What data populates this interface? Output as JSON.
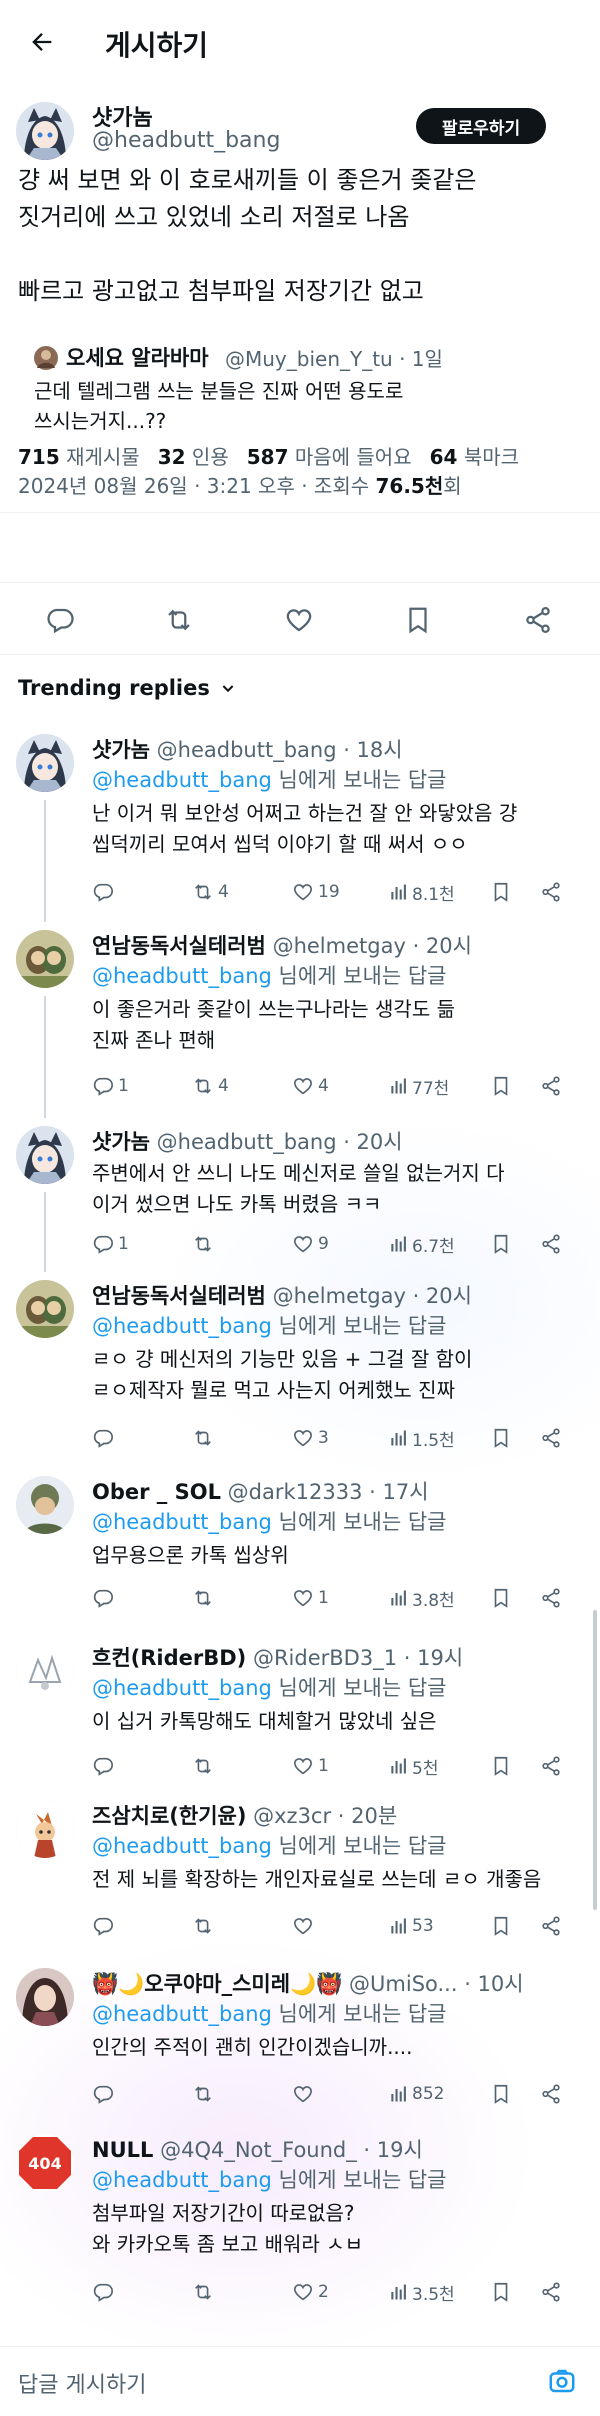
{
  "header": {
    "title": "게시하기"
  },
  "post": {
    "name": "샷가놈",
    "handle": "@headbutt_bang",
    "follow_label": "팔로우하기",
    "lines": [
      "걍 써 보면 와 이 호로새끼들 이 좋은거 좆같은",
      "짓거리에 쓰고 있었네 소리 저절로 나옴",
      "",
      "빠르고 광고없고 첨부파일 저장기간 없고"
    ],
    "quote": {
      "name": "오세요 알라바마",
      "handle": "@Muy_bien_Y_tu · 1일",
      "lines": [
        "근데 텔레그램 쓰는 분들은 진짜 어떤 용도로",
        "쓰시는거지...??"
      ]
    },
    "meta_prefix": "2024년 08월 26일 · 3:21 오후 · 조회수 ",
    "views": "76.5천",
    "meta_suffix": "회",
    "stats": [
      {
        "num": "715",
        "label": "재게시물"
      },
      {
        "num": "32",
        "label": "인용"
      },
      {
        "num": "587",
        "label": "마음에 들어요"
      },
      {
        "num": "64",
        "label": "북마크"
      }
    ]
  },
  "trending_label": "Trending replies",
  "replies": [
    {
      "name": "샷가놈",
      "handle": "@headbutt_bang",
      "time": " · 18시",
      "reply_to": "@headbutt_bang",
      "reply_suffix": " 님에게 보내는 답글",
      "lines": [
        "난 이거 뭐 보안성 어쩌고 하는건 잘 안 와닿았음 걍",
        "씹덕끼리 모여서 씹덕 이야기 할 때 써서 ㅇㅇ"
      ],
      "counts": {
        "reply": "",
        "retweet": "4",
        "like": "19",
        "views": "8.1천"
      }
    },
    {
      "name": "연남동독서실테러범",
      "handle": "@helmetgay",
      "time": " · 20시",
      "reply_to": "@headbutt_bang",
      "reply_suffix": " 님에게 보내는 답글",
      "lines": [
        "이 좋은거라 좆같이 쓰는구나라는 생각도 듦",
        "진짜 존나 편해"
      ],
      "counts": {
        "reply": "1",
        "retweet": "4",
        "like": "4",
        "views": "77천"
      }
    },
    {
      "name": "샷가놈",
      "handle": "@headbutt_bang",
      "time": " · 20시",
      "reply_to": "",
      "reply_suffix": "",
      "lines": [
        "주변에서 안 쓰니 나도 메신저로 쓸일 없는거지 다",
        "이거 썼으면 나도 카톡 버렸음 ㅋㅋ"
      ],
      "counts": {
        "reply": "1",
        "retweet": "",
        "like": "9",
        "views": "6.7천"
      }
    },
    {
      "name": "연남동독서실테러범",
      "handle": "@helmetgay",
      "time": " · 20시",
      "reply_to": "@headbutt_bang",
      "reply_suffix": " 님에게 보내는 답글",
      "lines": [
        "ㄹㅇ 걍 메신저의 기능만 있음 + 그걸 잘 함이",
        "ㄹㅇ제작자 뭘로 먹고 사는지 어케했노 진짜"
      ],
      "counts": {
        "reply": "",
        "retweet": "",
        "like": "3",
        "views": "1.5천"
      }
    },
    {
      "name": "Ober _ SOL",
      "handle": "@dark12333",
      "time": " · 17시",
      "reply_to": "@headbutt_bang",
      "reply_suffix": " 님에게 보내는 답글",
      "lines": [
        "업무용으론 카톡 씹상위"
      ],
      "counts": {
        "reply": "",
        "retweet": "",
        "like": "1",
        "views": "3.8천"
      }
    },
    {
      "name": "흐컨(RiderBD)",
      "handle": "@RiderBD3_1",
      "time": " · 19시",
      "reply_to": "@headbutt_bang",
      "reply_suffix": " 님에게 보내는 답글",
      "lines": [
        "이 십거 카톡망해도 대체할거 많았네 싶은"
      ],
      "counts": {
        "reply": "",
        "retweet": "",
        "like": "1",
        "views": "5천"
      }
    },
    {
      "name": "즈삼치로(한기윤)",
      "handle": "@xz3cr",
      "time": " · 20분",
      "reply_to": "@headbutt_bang",
      "reply_suffix": " 님에게 보내는 답글",
      "lines": [
        "전 제 뇌를 확장하는 개인자료실로 쓰는데 ㄹㅇ 개좋음"
      ],
      "counts": {
        "reply": "",
        "retweet": "",
        "like": "",
        "views": "53"
      }
    },
    {
      "name": "👹🌙오쿠야마_스미레🌙👹",
      "handle": "@UmiSo...",
      "time": " · 10시",
      "reply_to": "@headbutt_bang",
      "reply_suffix": " 님에게 보내는 답글",
      "lines": [
        "인간의 주적이 괜히 인간이겠습니까...."
      ],
      "counts": {
        "reply": "",
        "retweet": "",
        "like": "",
        "views": "852"
      }
    },
    {
      "name": "NULL",
      "handle": "@4Q4_Not_Found_",
      "time": " · 19시",
      "reply_to": "@headbutt_bang",
      "reply_suffix": " 님에게 보내는 답글",
      "lines": [
        "첨부파일 저장기간이 따로없음?",
        "와 카카오톡 좀 보고 배워라 ㅅㅂ"
      ],
      "counts": {
        "reply": "",
        "retweet": "",
        "like": "2",
        "views": "3.5천"
      }
    }
  ],
  "composer": {
    "placeholder": "답글 게시하기"
  },
  "colors": {
    "accent": "#1d9bf0",
    "text": "#0f1419",
    "muted": "#536471",
    "follow_bg": "#0f1419",
    "null_badge": "#e0352b"
  }
}
